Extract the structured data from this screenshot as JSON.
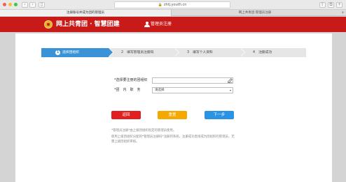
{
  "browser": {
    "url": "zhtj.youth.cn",
    "tabs": [
      {
        "label": "注册账号并成为团的管理员",
        "active": true
      },
      {
        "label": "网上共青团·管理员注册",
        "active": false
      }
    ]
  },
  "header": {
    "title": "网上共青团 · 智慧团建",
    "admin_register": "管理员注册"
  },
  "steps": [
    {
      "num": "1",
      "label": "选择团组织",
      "active": true
    },
    {
      "num": "2",
      "label": "填写管理员注册码",
      "active": false
    },
    {
      "num": "3",
      "label": "填写个人资料",
      "active": false
    },
    {
      "num": "4",
      "label": "注册成功",
      "active": false
    }
  ],
  "form": {
    "org_label": "*选择要注册的团组织",
    "org_value": "",
    "position_label": "*团　内　职　务",
    "position_value": "请选择"
  },
  "buttons": {
    "back": "返回",
    "reset": "重置",
    "next": "下一步"
  },
  "notes": [
    "*管理员注册*由上级团组织指定的管理员使用。",
    "使用上级团组织分配的*管理员注册码*注册到系统，注册成功直接成为团组织的管理员，无需上级团组织审核。"
  ]
}
